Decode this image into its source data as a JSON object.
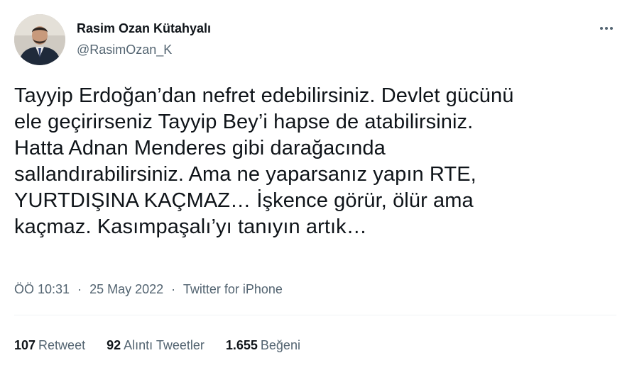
{
  "author": {
    "display_name": "Rasim Ozan Kütahyalı",
    "handle": "@RasimOzan_K",
    "avatar_icon": "profile-photo"
  },
  "more_icon": "more-horizontal-icon",
  "tweet": {
    "lines": [
      "Tayyip Erdoğan’dan nefret edebilirsiniz. Devlet gücünü",
      "ele geçirirseniz Tayyip Bey’i hapse de atabilirsiniz.",
      "Hatta Adnan Menderes gibi darağacında",
      "sallandırabilirsiniz. Ama ne yaparsanız yapın RTE,",
      "YURTDIŞINA KAÇMAZ… İşkence görür, ölür ama",
      "kaçmaz. Kasımpaşalı’yı tanıyın artık…"
    ]
  },
  "meta": {
    "time": "ÖÖ 10:31",
    "separator": "·",
    "date": "25 May 2022",
    "source": "Twitter for iPhone"
  },
  "stats": {
    "retweets_count": "107",
    "retweets_label": "Retweet",
    "quotes_count": "92",
    "quotes_label": "Alıntı Tweetler",
    "likes_count": "1.655",
    "likes_label": "Beğeni"
  },
  "colors": {
    "text_primary": "#0f1419",
    "text_secondary": "#536471",
    "divider": "#eff3f4"
  }
}
